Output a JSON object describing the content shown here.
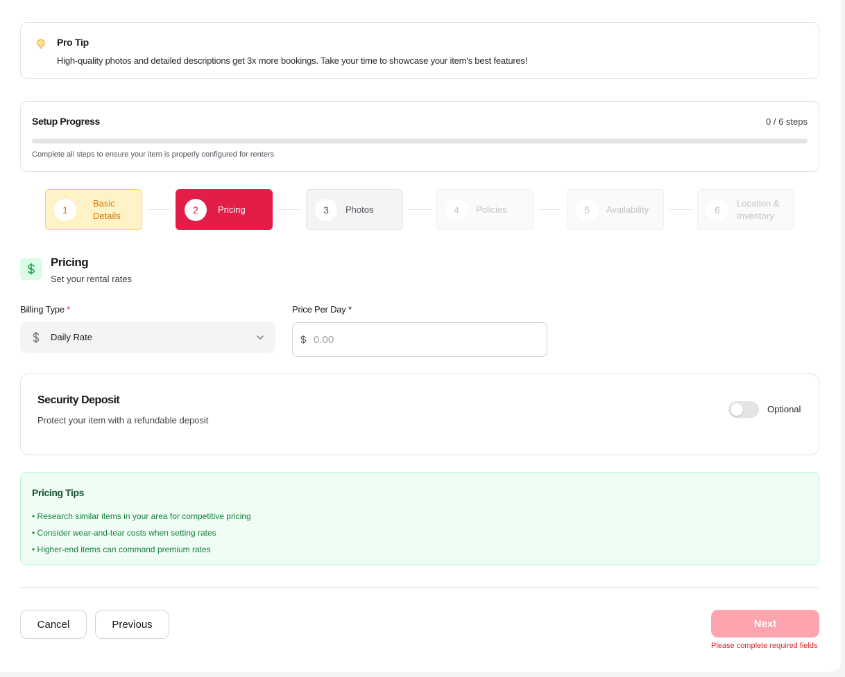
{
  "pro_tip": {
    "title": "Pro Tip",
    "text": "High-quality photos and detailed descriptions get 3x more bookings. Take your time to showcase your item's best features!"
  },
  "progress": {
    "title": "Setup Progress",
    "count_label": "0 / 6 steps",
    "completed_steps": 0,
    "total_steps": 6,
    "note": "Complete all steps to ensure your item is properly configured for renters"
  },
  "steps": [
    {
      "number": "1",
      "label": "Basic Details",
      "state": "completed"
    },
    {
      "number": "2",
      "label": "Pricing",
      "state": "active"
    },
    {
      "number": "3",
      "label": "Photos",
      "state": "next"
    },
    {
      "number": "4",
      "label": "Policies",
      "state": "upcoming"
    },
    {
      "number": "5",
      "label": "Availability",
      "state": "upcoming"
    },
    {
      "number": "6",
      "label": "Location & Inventory",
      "state": "upcoming"
    }
  ],
  "section": {
    "icon": "dollar-icon",
    "title": "Pricing",
    "subtitle": "Set your rental rates"
  },
  "billing": {
    "label": "Billing Type",
    "required_mark": "*",
    "value": "Daily Rate"
  },
  "price": {
    "label": "Price Per Day *",
    "currency": "$",
    "placeholder": "0.00",
    "value": ""
  },
  "deposit": {
    "title": "Security Deposit",
    "subtitle": "Protect your item with a refundable deposit",
    "toggle_on": false,
    "toggle_label": "Optional"
  },
  "tips": {
    "title": "Pricing Tips",
    "items": [
      "• Research similar items in your area for competitive pricing",
      "• Consider wear-and-tear costs when setting rates",
      "• Higher-end items can command premium rates"
    ]
  },
  "footer": {
    "cancel_label": "Cancel",
    "previous_label": "Previous",
    "next_label": "Next",
    "error_text": "Please complete required fields"
  },
  "colors": {
    "accent": "#e11d48",
    "completed": "#d97706",
    "success": "#15803d"
  }
}
